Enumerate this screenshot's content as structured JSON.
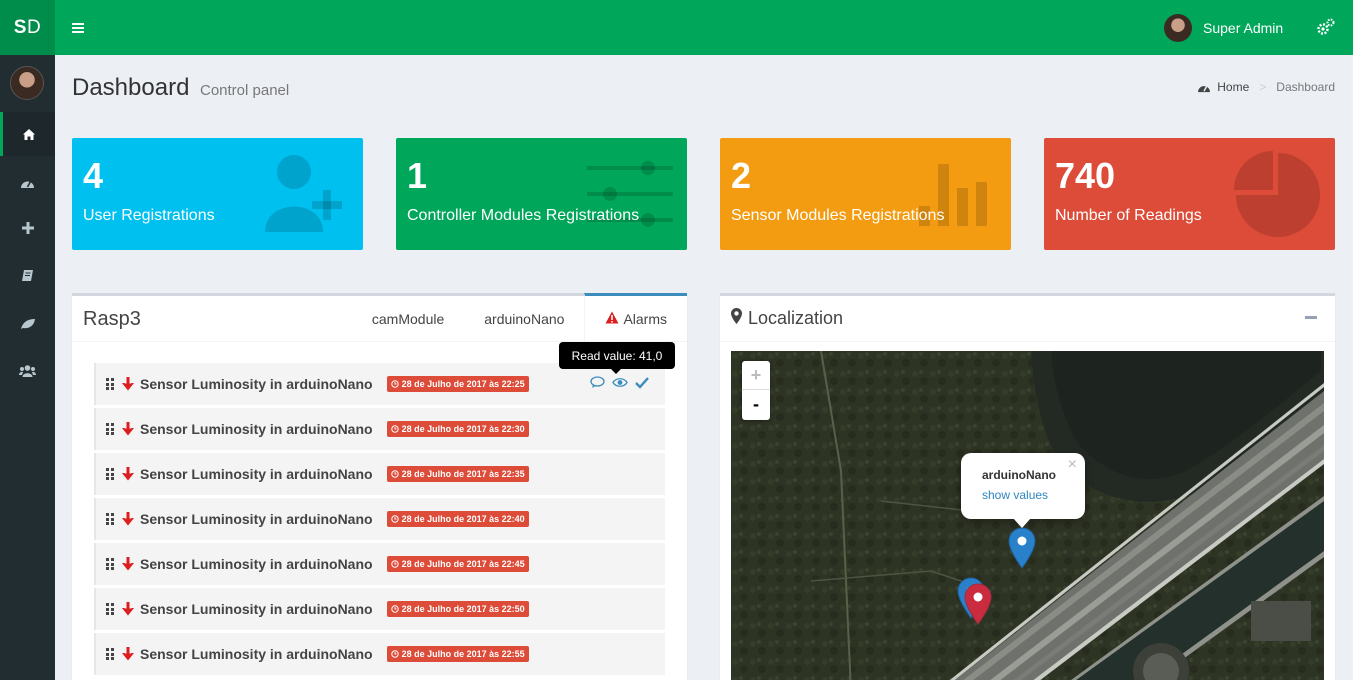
{
  "app": {
    "logo_bold": "S",
    "logo_rest": "D"
  },
  "header": {
    "user_name": "Super Admin"
  },
  "page": {
    "title": "Dashboard",
    "subtitle": "Control panel"
  },
  "breadcrumb": {
    "home": "Home",
    "current": "Dashboard"
  },
  "stats": [
    {
      "value": "4",
      "label": "User Registrations",
      "color": "#00c0ef",
      "icon": "user-plus-icon"
    },
    {
      "value": "1",
      "label": "Controller Modules Registrations",
      "color": "#00a65a",
      "icon": "sliders-icon"
    },
    {
      "value": "2",
      "label": "Sensor Modules Registrations",
      "color": "#f39c12",
      "icon": "bar-chart-icon"
    },
    {
      "value": "740",
      "label": "Number of Readings",
      "color": "#dd4b39",
      "icon": "pie-chart-icon"
    }
  ],
  "rasp": {
    "title": "Rasp3",
    "tabs": [
      "camModule",
      "arduinoNano",
      "Alarms"
    ],
    "active_tab": "Alarms",
    "tooltip": "Read value: 41,0",
    "alarms": [
      {
        "text": "Sensor Luminosity in arduinoNano",
        "time": "28 de Julho de 2017 às 22:25"
      },
      {
        "text": "Sensor Luminosity in arduinoNano",
        "time": "28 de Julho de 2017 às 22:30"
      },
      {
        "text": "Sensor Luminosity in arduinoNano",
        "time": "28 de Julho de 2017 às 22:35"
      },
      {
        "text": "Sensor Luminosity in arduinoNano",
        "time": "28 de Julho de 2017 às 22:40"
      },
      {
        "text": "Sensor Luminosity in arduinoNano",
        "time": "28 de Julho de 2017 às 22:45"
      },
      {
        "text": "Sensor Luminosity in arduinoNano",
        "time": "28 de Julho de 2017 às 22:50"
      },
      {
        "text": "Sensor Luminosity in arduinoNano",
        "time": "28 de Julho de 2017 às 22:55"
      }
    ]
  },
  "localization": {
    "title": "Localization",
    "zoom_in": "+",
    "zoom_out": "-",
    "popup_title": "arduinoNano",
    "popup_link": "show values",
    "popup_close": "×"
  },
  "sidebar": {
    "items": [
      "home-icon",
      "dashboard-icon",
      "plus-icon",
      "book-icon",
      "leaf-icon",
      "users-icon"
    ]
  }
}
